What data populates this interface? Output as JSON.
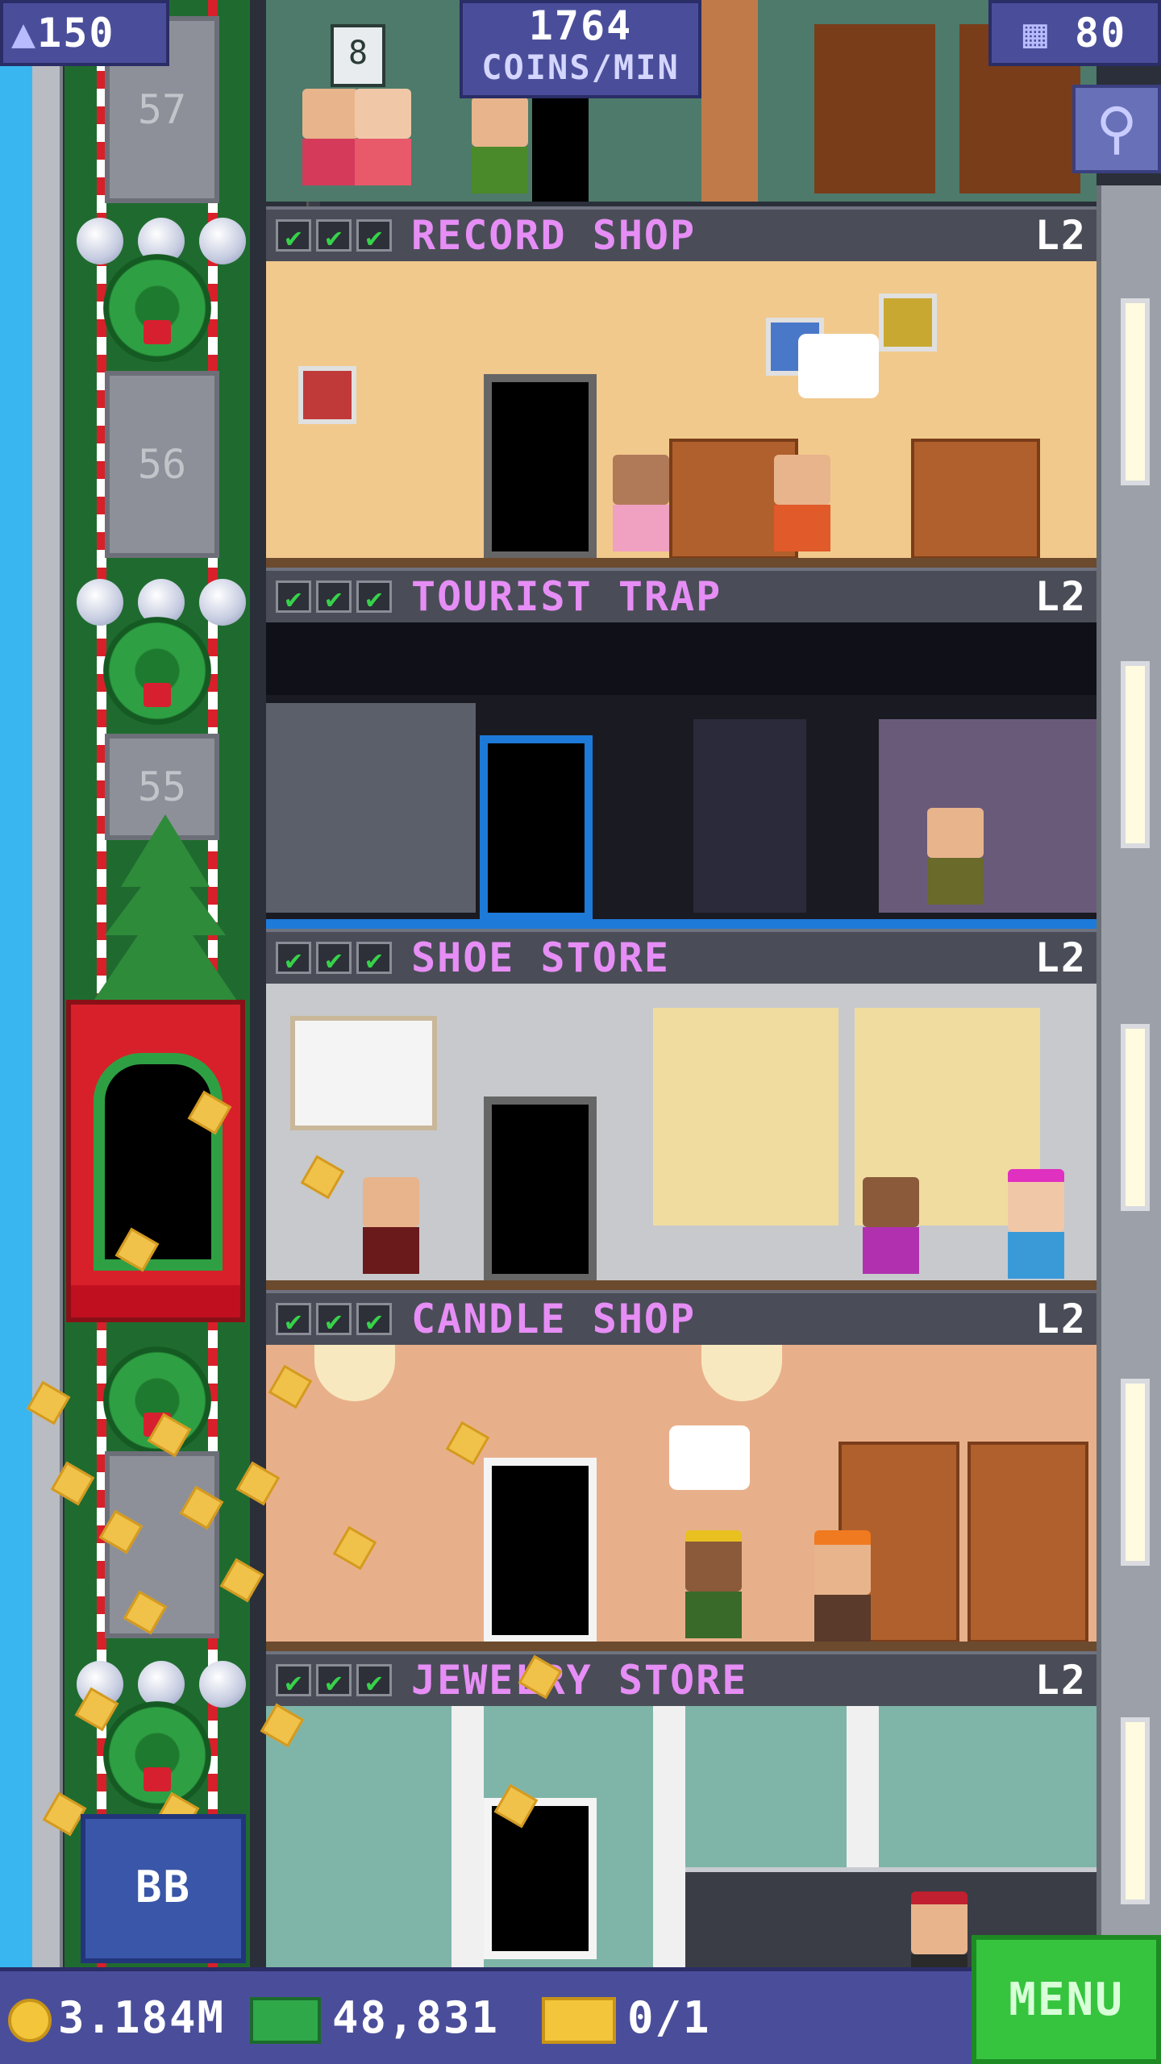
{
  "hud": {
    "population": "150",
    "coins_per_min_value": "1764",
    "coins_per_min_unit": "COINS/MIN",
    "floor_count": "80",
    "top_floor_badge": "8"
  },
  "shaft": {
    "floor_numbers": [
      "57",
      "56",
      "55"
    ],
    "bb_label": "BB"
  },
  "floors": [
    {
      "name": "RECORD SHOP",
      "level": "L2",
      "checks": [
        "✔",
        "✔",
        "✔"
      ]
    },
    {
      "name": "TOURIST TRAP",
      "level": "L2",
      "checks": [
        "✔",
        "✔",
        "✔"
      ]
    },
    {
      "name": "SHOE STORE",
      "level": "L2",
      "checks": [
        "✔",
        "✔",
        "✔"
      ]
    },
    {
      "name": "CANDLE SHOP",
      "level": "L2",
      "checks": [
        "✔",
        "✔",
        "✔"
      ]
    },
    {
      "name": "JEWELRY STORE",
      "level": "L2",
      "checks": [
        "✔",
        "✔",
        "✔"
      ]
    }
  ],
  "bottom_bar": {
    "coins": "3.184M",
    "bux": "48,831",
    "tickets": "0/1",
    "menu_label": "MENU"
  },
  "icons": {
    "population": "person-icon",
    "floors": "building-icon",
    "search": "magnifier-icon",
    "coin": "coin-icon",
    "bux": "bux-icon",
    "ticket": "golden-ticket-icon"
  },
  "colors": {
    "floor_name": "#e68ef5",
    "check": "#37d24a",
    "menu": "#36c43e",
    "hud": "#4a4e9a",
    "elevator": "#d8202a"
  }
}
